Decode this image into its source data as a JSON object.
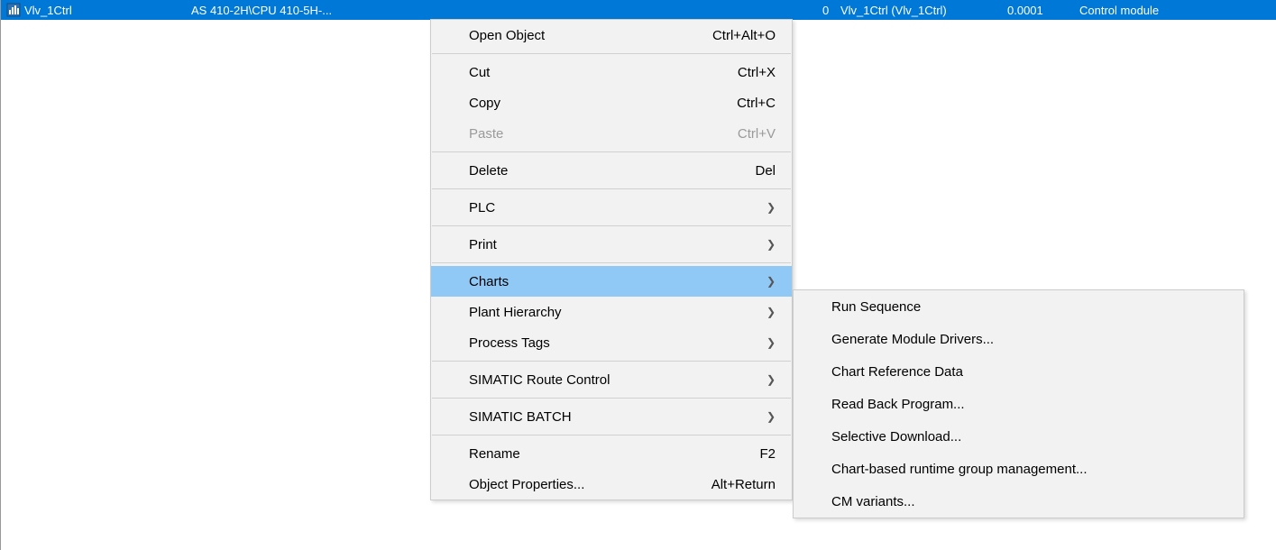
{
  "row": {
    "name": "Vlv_1Ctrl",
    "path": "AS 410-2H\\CPU 410-5H-...",
    "zero": "0",
    "alias": "Vlv_1Ctrl (Vlv_1Ctrl)",
    "num": "0.0001",
    "type": "Control module"
  },
  "menu": {
    "open_object": "Open Object",
    "open_object_sc": "Ctrl+Alt+O",
    "cut": "Cut",
    "cut_sc": "Ctrl+X",
    "copy": "Copy",
    "copy_sc": "Ctrl+C",
    "paste": "Paste",
    "paste_sc": "Ctrl+V",
    "delete": "Delete",
    "delete_sc": "Del",
    "plc": "PLC",
    "print": "Print",
    "charts": "Charts",
    "plant_hierarchy": "Plant Hierarchy",
    "process_tags": "Process Tags",
    "route_control": "SIMATIC Route Control",
    "batch": "SIMATIC BATCH",
    "rename": "Rename",
    "rename_sc": "F2",
    "object_props": "Object Properties...",
    "object_props_sc": "Alt+Return"
  },
  "submenu": {
    "run_sequence": "Run Sequence",
    "gen_drivers": "Generate Module Drivers...",
    "chart_ref": "Chart Reference Data",
    "read_back": "Read Back Program...",
    "selective_dl": "Selective Download...",
    "runtime_group": "Chart-based runtime group management...",
    "cm_variants": "CM variants..."
  }
}
